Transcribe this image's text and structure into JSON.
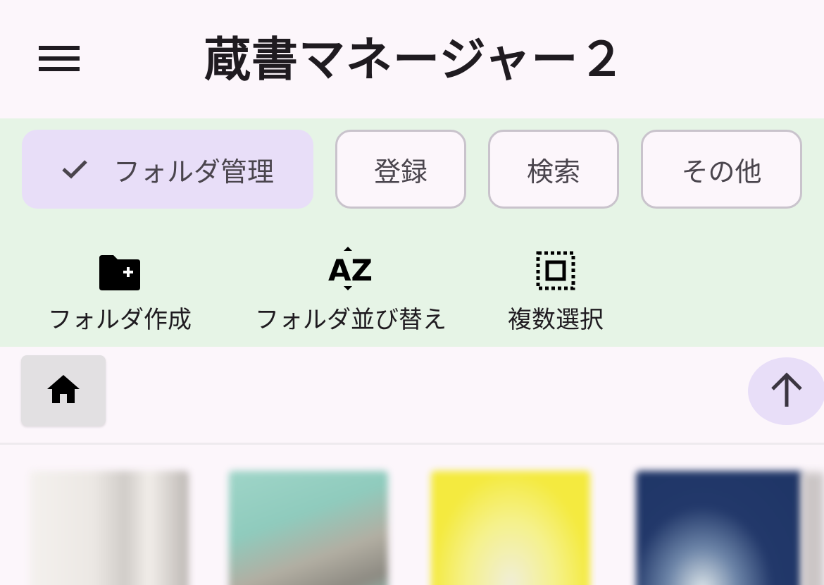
{
  "app": {
    "title": "蔵書マネージャー２"
  },
  "tabs": [
    {
      "label": "フォルダ管理",
      "selected": true
    },
    {
      "label": "登録",
      "selected": false
    },
    {
      "label": "検索",
      "selected": false
    },
    {
      "label": "その他",
      "selected": false
    }
  ],
  "actions": [
    {
      "label": "フォルダ作成",
      "icon": "create-folder-icon"
    },
    {
      "label": "フォルダ並び替え",
      "icon": "sort-az-icon"
    },
    {
      "label": "複数選択",
      "icon": "select-all-icon"
    }
  ],
  "nav": {
    "home_icon": "home-icon",
    "up_icon": "arrow-up-icon"
  },
  "books": [
    {
      "cover": "book-cover-1"
    },
    {
      "cover": "book-cover-2"
    },
    {
      "cover": "book-cover-3"
    },
    {
      "cover": "book-cover-4"
    }
  ],
  "colors": {
    "background": "#fcf6fb",
    "panel": "#e6f4e6",
    "selected_chip": "#e8def8",
    "chip_border": "#c9c3cc",
    "text": "#1f1b20"
  }
}
